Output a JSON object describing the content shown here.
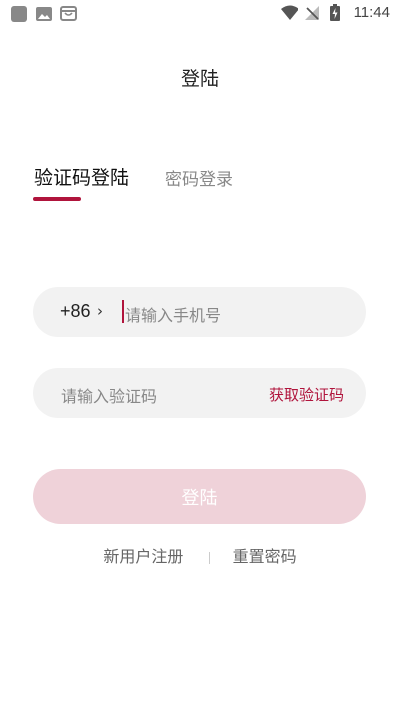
{
  "status_bar": {
    "time": "11:44",
    "left_icons": [
      "square-app-icon",
      "image-icon",
      "shopping-bag-icon"
    ],
    "right_icons": [
      "wifi-icon",
      "no-signal-icon",
      "battery-charging-icon"
    ]
  },
  "header": {
    "title": "登陆"
  },
  "tabs": {
    "active_label": "验证码登陆",
    "inactive_label": "密码登录",
    "accent_color": "#b0143c"
  },
  "phone": {
    "country_code": "+86",
    "chevron": "›",
    "placeholder": "请输入手机号"
  },
  "code": {
    "placeholder": "请输入验证码",
    "get_code_label": "获取验证码"
  },
  "login_button": {
    "label": "登陆",
    "color": "#efd2d9"
  },
  "links": {
    "register": "新用户注册",
    "reset_password": "重置密码"
  }
}
